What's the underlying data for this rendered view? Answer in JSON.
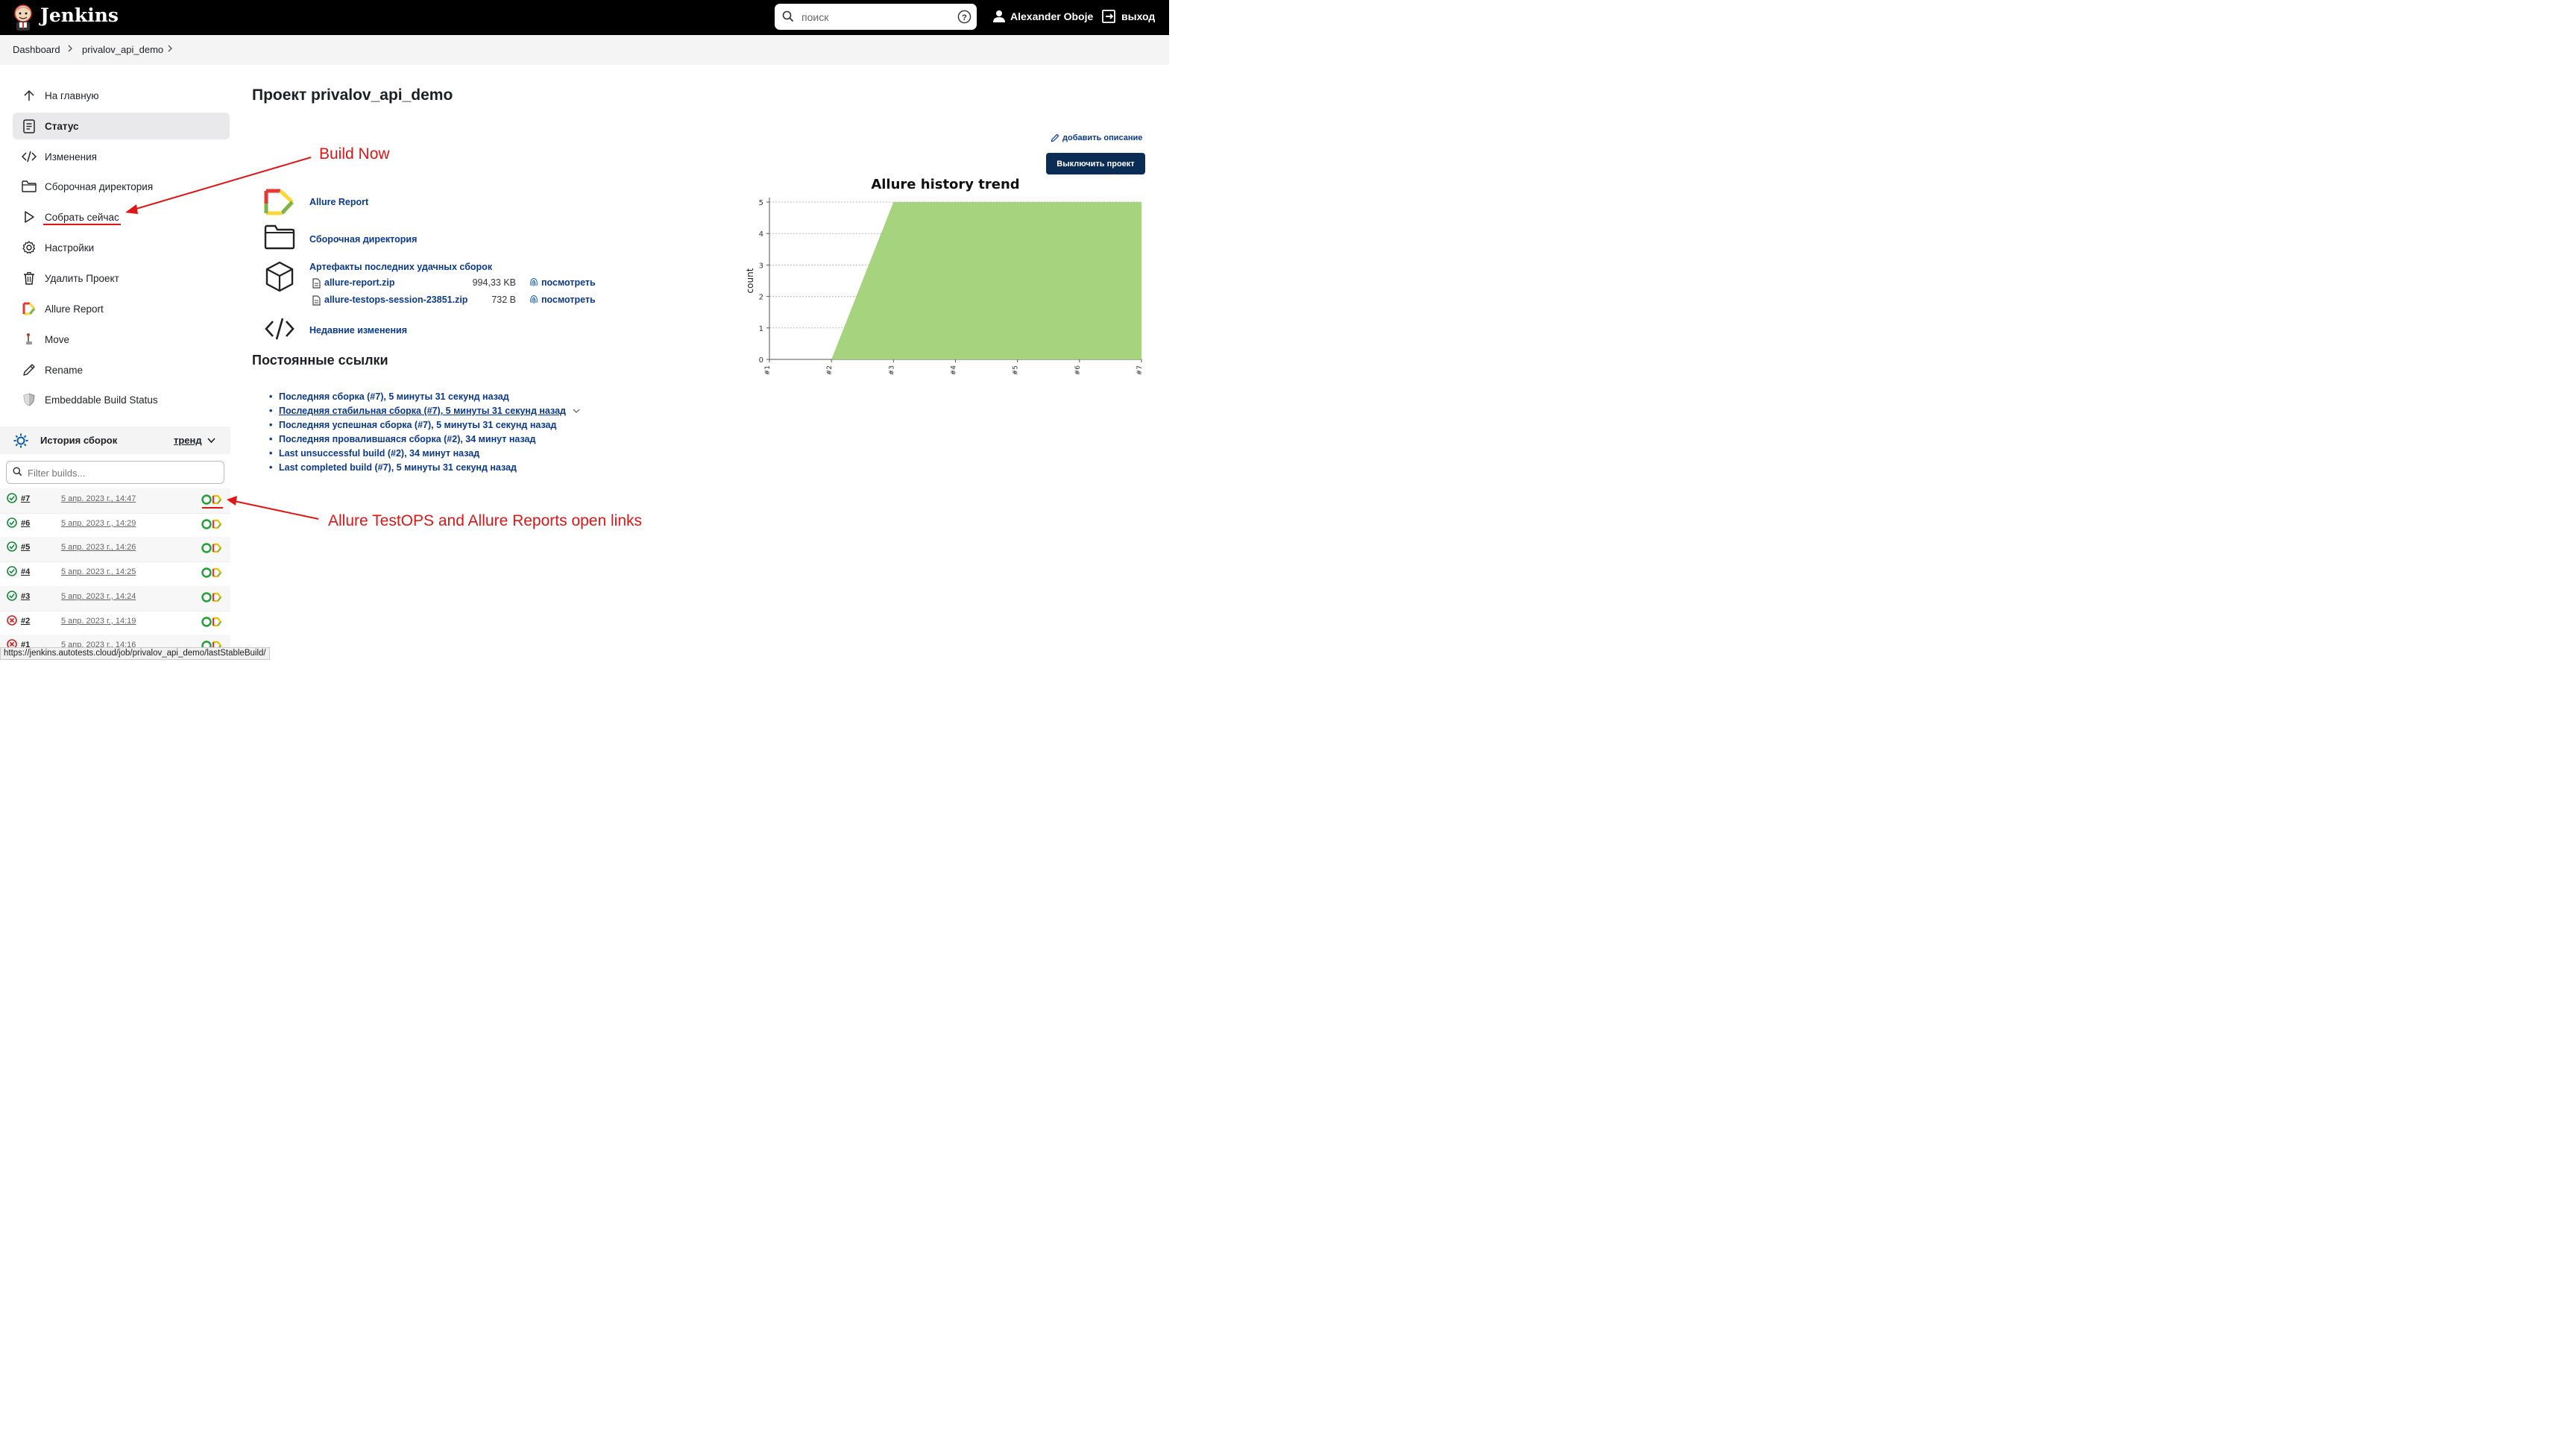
{
  "header": {
    "brand": "Jenkins",
    "search_placeholder": "поиск",
    "user_name": "Alexander Oboje",
    "logout_label": "выход"
  },
  "breadcrumb": [
    "Dashboard",
    "privalov_api_demo"
  ],
  "sidebar": {
    "items": [
      {
        "label": "На главную",
        "icon": "arrow-up-icon"
      },
      {
        "label": "Статус",
        "icon": "document-icon",
        "active": true
      },
      {
        "label": "Изменения",
        "icon": "code-icon"
      },
      {
        "label": "Сборочная директория",
        "icon": "folder-icon"
      },
      {
        "label": "Собрать сейчас",
        "icon": "play-icon"
      },
      {
        "label": "Настройки",
        "icon": "gear-icon"
      },
      {
        "label": "Удалить Проект",
        "icon": "trash-icon"
      },
      {
        "label": "Allure Report",
        "icon": "allure-icon"
      },
      {
        "label": "Move",
        "icon": "move-icon"
      },
      {
        "label": "Rename",
        "icon": "pencil-icon"
      },
      {
        "label": "Embeddable Build Status",
        "icon": "shield-icon"
      }
    ]
  },
  "history": {
    "title": "История сборок",
    "trend_label": "тренд",
    "filter_placeholder": "Filter builds...",
    "builds": [
      {
        "num": "#7",
        "date": "5 апр. 2023 г., 14:47",
        "status": "success"
      },
      {
        "num": "#6",
        "date": "5 апр. 2023 г., 14:29",
        "status": "success"
      },
      {
        "num": "#5",
        "date": "5 апр. 2023 г., 14:26",
        "status": "success"
      },
      {
        "num": "#4",
        "date": "5 апр. 2023 г., 14:25",
        "status": "success"
      },
      {
        "num": "#3",
        "date": "5 апр. 2023 г., 14:24",
        "status": "success"
      },
      {
        "num": "#2",
        "date": "5 апр. 2023 г., 14:19",
        "status": "failed"
      },
      {
        "num": "#1",
        "date": "5 апр. 2023 г., 14:16",
        "status": "failed"
      }
    ]
  },
  "main": {
    "title": "Проект privalov_api_demo",
    "add_description": "добавить описание",
    "disable_button": "Выключить проект",
    "links": {
      "allure": "Allure Report",
      "workspace": "Сборочная директория",
      "artifacts": "Артефакты последних удачных сборок",
      "changes": "Недавние изменения"
    },
    "artifacts": [
      {
        "name": "allure-report.zip",
        "size": "994,33 KB",
        "view": "посмотреть"
      },
      {
        "name": "allure-testops-session-23851.zip",
        "size": "732 B",
        "view": "посмотреть"
      }
    ],
    "permalinks_title": "Постоянные ссылки",
    "permalinks": [
      "Последняя сборка (#7), 5 минуты 31 секунд назад",
      "Последняя стабильная сборка (#7), 5 минуты 31 секунд назад",
      "Последняя успешная сборка (#7), 5 минуты 31 секунд назад",
      "Последняя провалившаяся сборка (#2), 34 минут назад",
      "Last unsuccessful build (#2), 34 минут назад",
      "Last completed build (#7), 5 минуты 31 секунд назад"
    ]
  },
  "chart_data": {
    "type": "area",
    "title": "Allure history trend",
    "ylabel": "count",
    "xlabel": "",
    "categories": [
      "#1",
      "#2",
      "#3",
      "#4",
      "#5",
      "#6",
      "#7"
    ],
    "series": [
      {
        "values": [
          0,
          0,
          5,
          5,
          5,
          5,
          5
        ],
        "color": "#a6d37d"
      }
    ],
    "ylim": [
      0,
      5
    ],
    "yticks": [
      0,
      1,
      2,
      3,
      4,
      5
    ],
    "grid": true
  },
  "annotations": {
    "build_now": "Build Now",
    "allure_links": "Allure TestOPS and Allure Reports open links"
  },
  "statusbar": "https://jenkins.autotests.cloud/job/privalov_api_demo/lastStableBuild/"
}
